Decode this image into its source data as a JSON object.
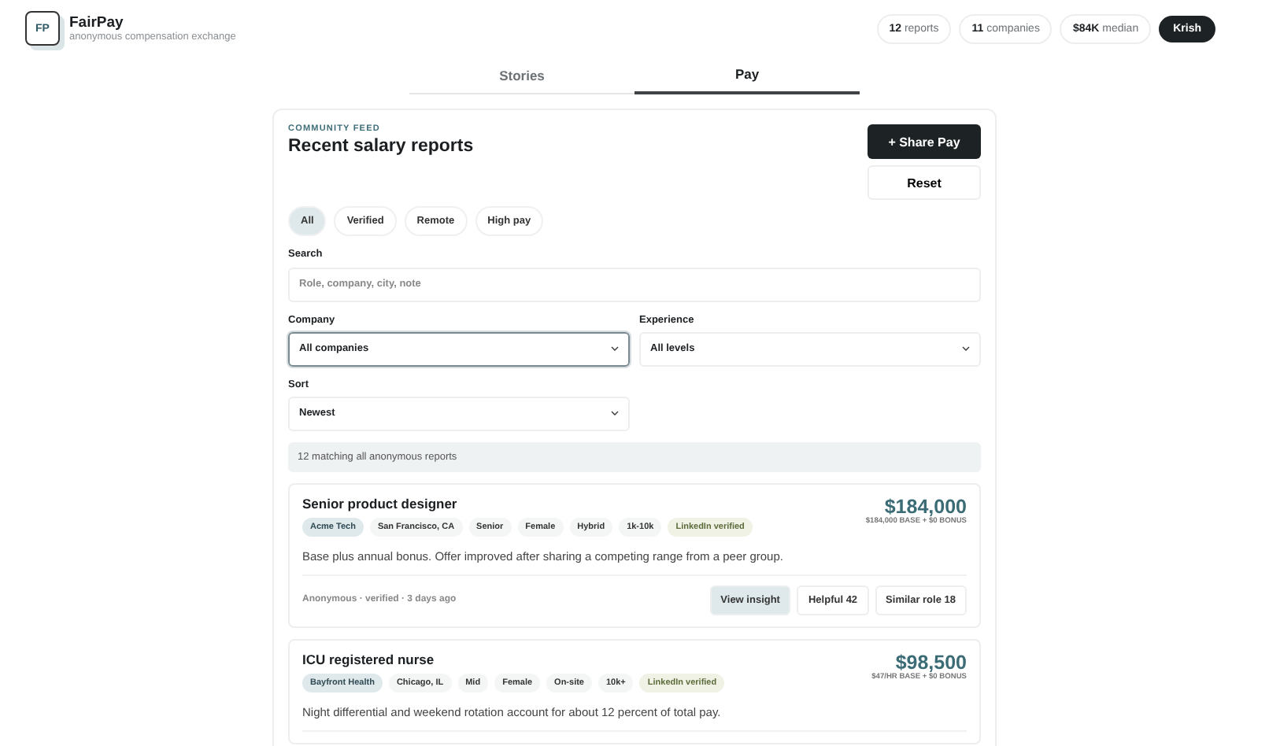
{
  "brand": {
    "logo": "FP",
    "name": "FairPay",
    "tagline": "anonymous compensation exchange"
  },
  "stats": [
    {
      "value": "12",
      "label": "reports"
    },
    {
      "value": "11",
      "label": "companies"
    },
    {
      "value": "$84K",
      "label": "median"
    }
  ],
  "user": "Krish",
  "tabs": [
    {
      "label": "Stories",
      "selected": false
    },
    {
      "label": "Pay",
      "selected": true
    }
  ],
  "feed": {
    "eyebrow": "COMMUNITY FEED",
    "title": "Recent salary reports",
    "primary_button": "+ Share Pay",
    "secondary_button": "Reset",
    "filters": [
      {
        "label": "All",
        "selected": true
      },
      {
        "label": "Verified",
        "selected": false
      },
      {
        "label": "Remote",
        "selected": false
      },
      {
        "label": "High pay",
        "selected": false
      }
    ],
    "search": {
      "label": "Search",
      "placeholder": "Role, company, city, note"
    },
    "company": {
      "label": "Company",
      "value": "All companies",
      "focused": true
    },
    "experience": {
      "label": "Experience",
      "value": "All levels",
      "focused": false
    },
    "sort": {
      "label": "Sort",
      "value": "Newest",
      "focused": false
    },
    "summary": "12 matching all anonymous reports",
    "reports": [
      {
        "title": "Senior product designer",
        "amount": "$184,000",
        "breakdown": "$184,000 BASE + $0 BONUS",
        "tags": [
          {
            "text": "Acme Tech",
            "kind": "company"
          },
          {
            "text": "San Francisco, CA",
            "kind": "plain"
          },
          {
            "text": "Senior",
            "kind": "plain"
          },
          {
            "text": "Female",
            "kind": "plain"
          },
          {
            "text": "Hybrid",
            "kind": "plain"
          },
          {
            "text": "1k-10k",
            "kind": "plain"
          },
          {
            "text": "LinkedIn verified",
            "kind": "verified"
          }
        ],
        "note": "Base plus annual bonus. Offer improved after sharing a competing range from a peer group.",
        "meta": "Anonymous · verified · 3 days ago",
        "actions": [
          {
            "label": "View insight",
            "selected": true
          },
          {
            "label": "Helpful 42",
            "selected": false
          },
          {
            "label": "Similar role 18",
            "selected": false
          }
        ]
      },
      {
        "title": "ICU registered nurse",
        "amount": "$98,500",
        "breakdown": "$47/HR BASE + $0 BONUS",
        "tags": [
          {
            "text": "Bayfront Health",
            "kind": "company"
          },
          {
            "text": "Chicago, IL",
            "kind": "plain"
          },
          {
            "text": "Mid",
            "kind": "plain"
          },
          {
            "text": "Female",
            "kind": "plain"
          },
          {
            "text": "On-site",
            "kind": "plain"
          },
          {
            "text": "10k+",
            "kind": "plain"
          },
          {
            "text": "LinkedIn verified",
            "kind": "verified"
          }
        ],
        "note": "Night differential and weekend rotation account for about 12 percent of total pay."
      }
    ]
  }
}
